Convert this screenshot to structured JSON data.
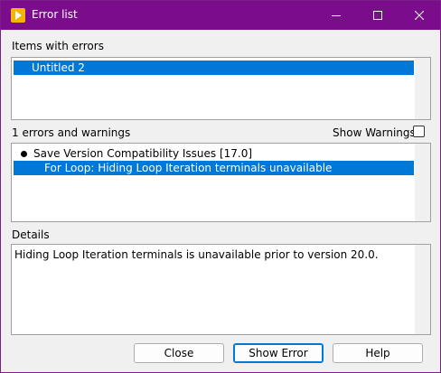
{
  "window": {
    "title": "Error list",
    "icon": "labview-run-icon",
    "controls": {
      "minimize": "minimize-icon",
      "maximize": "maximize-icon",
      "close": "close-icon"
    }
  },
  "items_section": {
    "label": "Items with errors",
    "items": [
      {
        "label": "Untitled 2",
        "selected": true
      }
    ]
  },
  "errors_section": {
    "count_label": "1 errors and warnings",
    "show_warnings_label": "Show Warnings",
    "show_warnings_checked": false,
    "items": [
      {
        "label": "Save Version Compatibility Issues [17.0]",
        "level": 0,
        "bullet": true,
        "selected": false
      },
      {
        "label": "For Loop: Hiding Loop Iteration terminals unavailable",
        "level": 1,
        "bullet": false,
        "selected": true
      }
    ]
  },
  "details_section": {
    "label": "Details",
    "text": "Hiding Loop Iteration terminals is unavailable prior to version 20.0."
  },
  "buttons": {
    "close": "Close",
    "show_error": "Show Error",
    "help": "Help"
  },
  "colors": {
    "titlebar": "#7b0d8d",
    "selection": "#0078d7",
    "app_icon": "#f5b400"
  }
}
